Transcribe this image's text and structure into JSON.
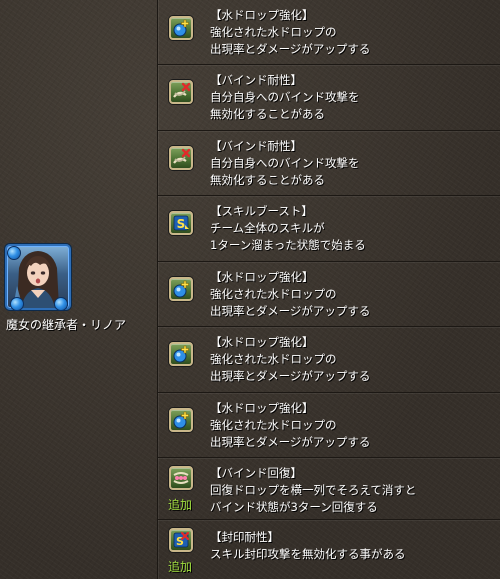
{
  "character": {
    "name": "魔女の継承者・リノア"
  },
  "awakenings": [
    {
      "icon": "water-orb-enhance-icon",
      "added": "",
      "title": "【水ドロップ強化】",
      "lines": [
        "強化された水ドロップの",
        "出現率とダメージがアップする"
      ]
    },
    {
      "icon": "bind-resist-icon",
      "added": "",
      "title": "【バインド耐性】",
      "lines": [
        "自分自身へのバインド攻撃を",
        "無効化することがある"
      ]
    },
    {
      "icon": "bind-resist-icon",
      "added": "",
      "title": "【バインド耐性】",
      "lines": [
        "自分自身へのバインド攻撃を",
        "無効化することがある"
      ]
    },
    {
      "icon": "skill-boost-icon",
      "added": "",
      "title": "【スキルブースト】",
      "lines": [
        "チーム全体のスキルが",
        "1ターン溜まった状態で始まる"
      ]
    },
    {
      "icon": "water-orb-enhance-icon",
      "added": "",
      "title": "【水ドロップ強化】",
      "lines": [
        "強化された水ドロップの",
        "出現率とダメージがアップする"
      ]
    },
    {
      "icon": "water-orb-enhance-icon",
      "added": "",
      "title": "【水ドロップ強化】",
      "lines": [
        "強化された水ドロップの",
        "出現率とダメージがアップする"
      ]
    },
    {
      "icon": "water-orb-enhance-icon",
      "added": "",
      "title": "【水ドロップ強化】",
      "lines": [
        "強化された水ドロップの",
        "出現率とダメージがアップする"
      ]
    },
    {
      "icon": "bind-recovery-icon",
      "added": "追加",
      "title": "【バインド回復】",
      "lines": [
        "回復ドロップを横一列でそろえて消すと",
        "バインド状態が3ターン回復する"
      ]
    },
    {
      "icon": "skill-bind-resist-icon",
      "added": "追加",
      "title": "【封印耐性】",
      "lines": [
        "スキル封印攻撃を無効化する事がある"
      ]
    }
  ]
}
